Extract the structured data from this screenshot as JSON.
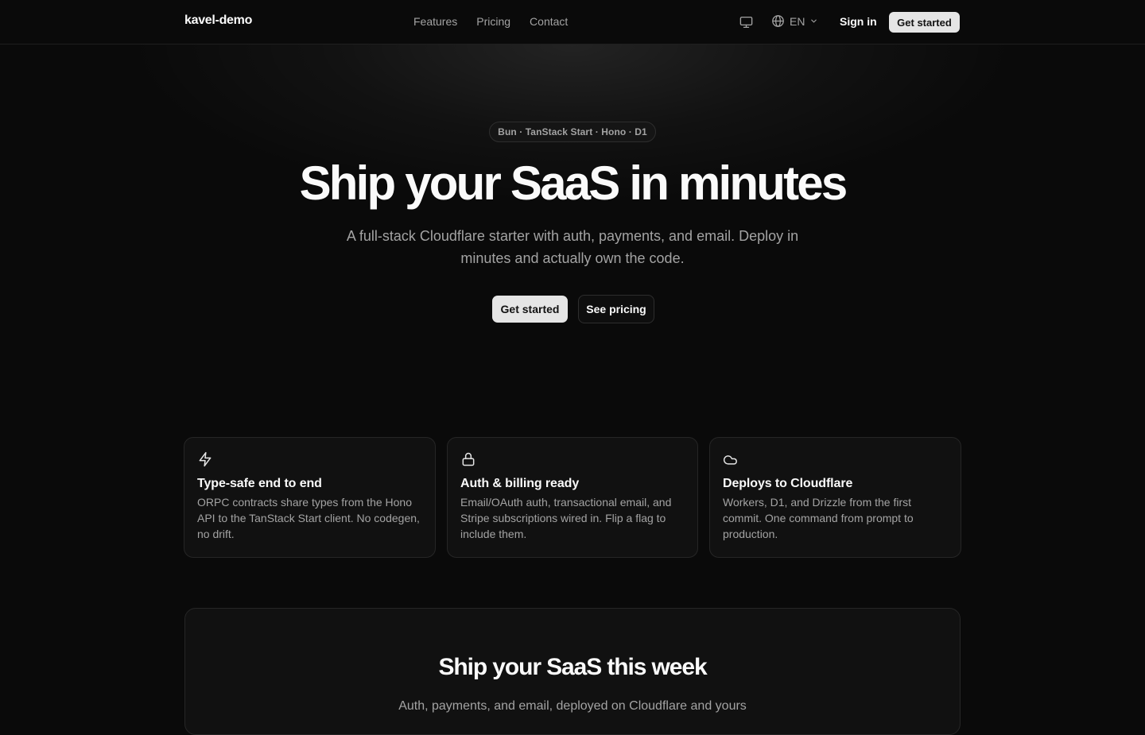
{
  "header": {
    "brand": "kavel-demo",
    "nav": [
      "Features",
      "Pricing",
      "Contact"
    ],
    "theme_icon": "monitor-icon",
    "language": "EN",
    "sign_in": "Sign in",
    "get_started": "Get started"
  },
  "hero": {
    "badge": "Bun · TanStack Start · Hono · D1",
    "title": "Ship your SaaS in minutes",
    "subtitle": "A full-stack Cloudflare starter with auth, payments, and email. Deploy in minutes and actually own the code.",
    "primary_button": "Get started",
    "secondary_button": "See pricing"
  },
  "features": [
    {
      "icon": "zap-icon",
      "title": "Type-safe end to end",
      "description": "ORPC contracts share types from the Hono API to the TanStack Start client. No codegen, no drift."
    },
    {
      "icon": "lock-icon",
      "title": "Auth & billing ready",
      "description": "Email/OAuth auth, transactional email, and Stripe subscriptions wired in. Flip a flag to include them."
    },
    {
      "icon": "cloud-icon",
      "title": "Deploys to Cloudflare",
      "description": "Workers, D1, and Drizzle from the first commit. One command from prompt to production."
    }
  ],
  "cta": {
    "title": "Ship your SaaS this week",
    "subtitle": "Auth, payments, and email, deployed on Cloudflare and yours"
  },
  "colors": {
    "background": "#0a0a0a",
    "card": "#111111",
    "border": "#262626",
    "muted_text": "#a3a3a3",
    "primary_button": "#e5e5e5"
  }
}
